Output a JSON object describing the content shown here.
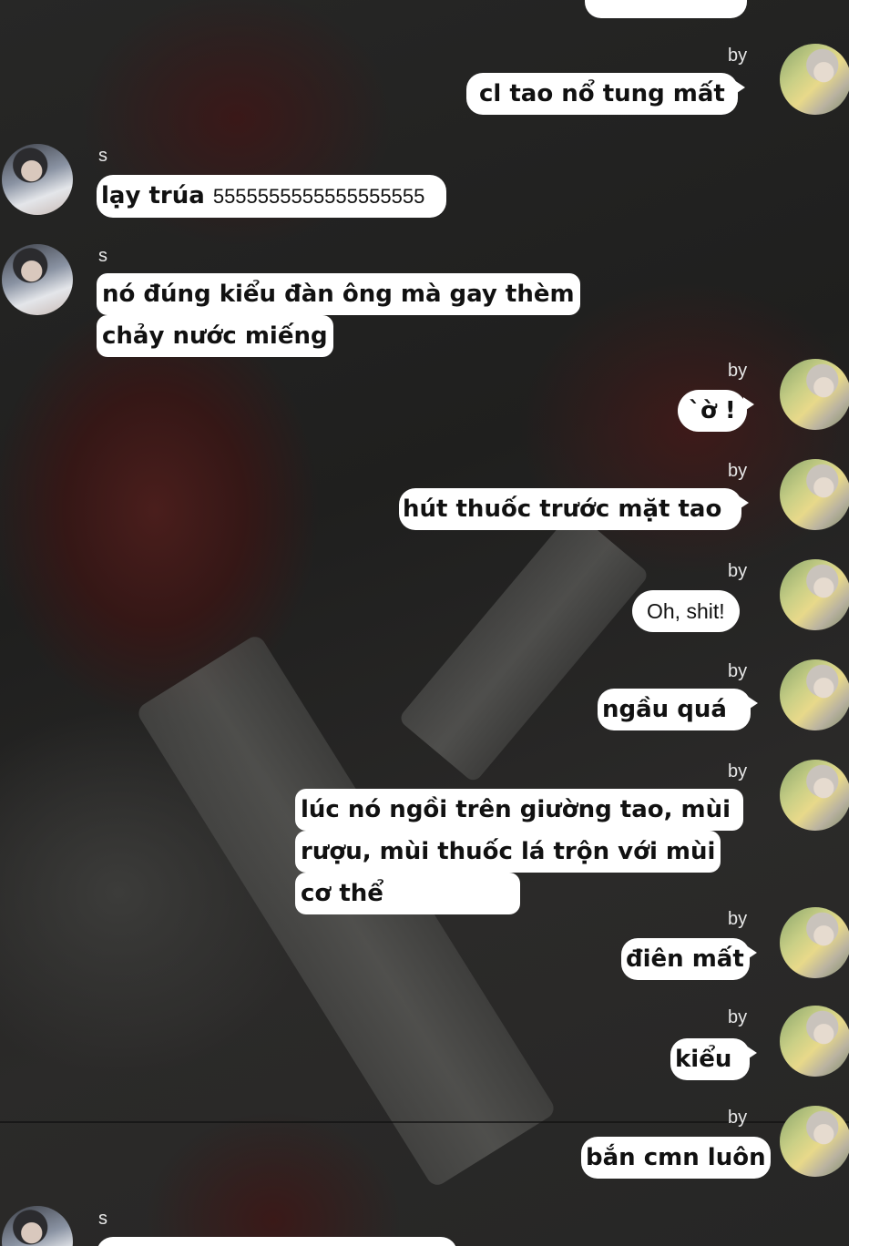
{
  "chat": {
    "top_partial_bubble": "",
    "messages": [
      {
        "sender": "by",
        "text": "cl tao nổ tung mất"
      },
      {
        "sender": "s",
        "text_bold": "lạy trúa",
        "text_thin": "5555555555555555555"
      },
      {
        "sender": "s",
        "lines": [
          "nó đúng kiểu đàn ông mà gay thèm",
          "chảy nước miếng"
        ]
      },
      {
        "sender": "by",
        "text": "`ờ !"
      },
      {
        "sender": "by",
        "text": "hút thuốc trước mặt tao"
      },
      {
        "sender": "by",
        "text": "Oh, shit!"
      },
      {
        "sender": "by",
        "text": "ngầu quá"
      },
      {
        "sender": "by",
        "lines": [
          "lúc nó ngồi trên giường tao, mùi",
          "rượu, mùi thuốc lá trộn với mùi",
          "cơ thể"
        ]
      },
      {
        "sender": "by",
        "text": "điên mất"
      },
      {
        "sender": "by",
        "text": "kiểu"
      },
      {
        "sender": "by",
        "text": "bắn cmn luôn"
      },
      {
        "sender": "s",
        "text": ""
      }
    ]
  }
}
